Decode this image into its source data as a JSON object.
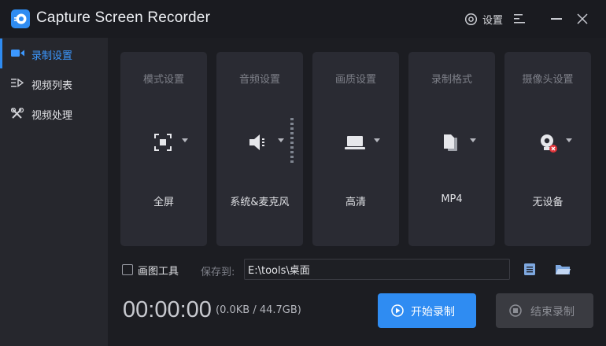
{
  "window": {
    "title": "Capture Screen Recorder",
    "settings_label": "设置"
  },
  "sidebar": {
    "items": [
      {
        "label": "录制设置",
        "icon": "camera-icon",
        "active": true
      },
      {
        "label": "视频列表",
        "icon": "video-list-icon",
        "active": false
      },
      {
        "label": "视频处理",
        "icon": "tools-icon",
        "active": false
      }
    ]
  },
  "cards": [
    {
      "title": "模式设置",
      "value": "全屏",
      "icon": "fullscreen-icon"
    },
    {
      "title": "音频设置",
      "value": "系统&麦克风",
      "icon": "speaker-icon"
    },
    {
      "title": "画质设置",
      "value": "高清",
      "icon": "laptop-icon"
    },
    {
      "title": "录制格式",
      "value": "MP4",
      "icon": "file-format-icon"
    },
    {
      "title": "摄像头设置",
      "value": "无设备",
      "icon": "webcam-icon"
    }
  ],
  "bottom": {
    "draw_tool_label": "画图工具",
    "save_to_label": "保存到:",
    "save_path": "E:\\tools\\桌面",
    "timer": "00:00:00",
    "size_info": "(0.0KB / 44.7GB)",
    "start_label": "开始录制",
    "stop_label": "结束录制"
  },
  "colors": {
    "accent": "#2f8cf2",
    "background": "#1c1d22",
    "sidebar": "#26272d",
    "card": "#2a2b33",
    "stop_button": "#3a3b41"
  }
}
